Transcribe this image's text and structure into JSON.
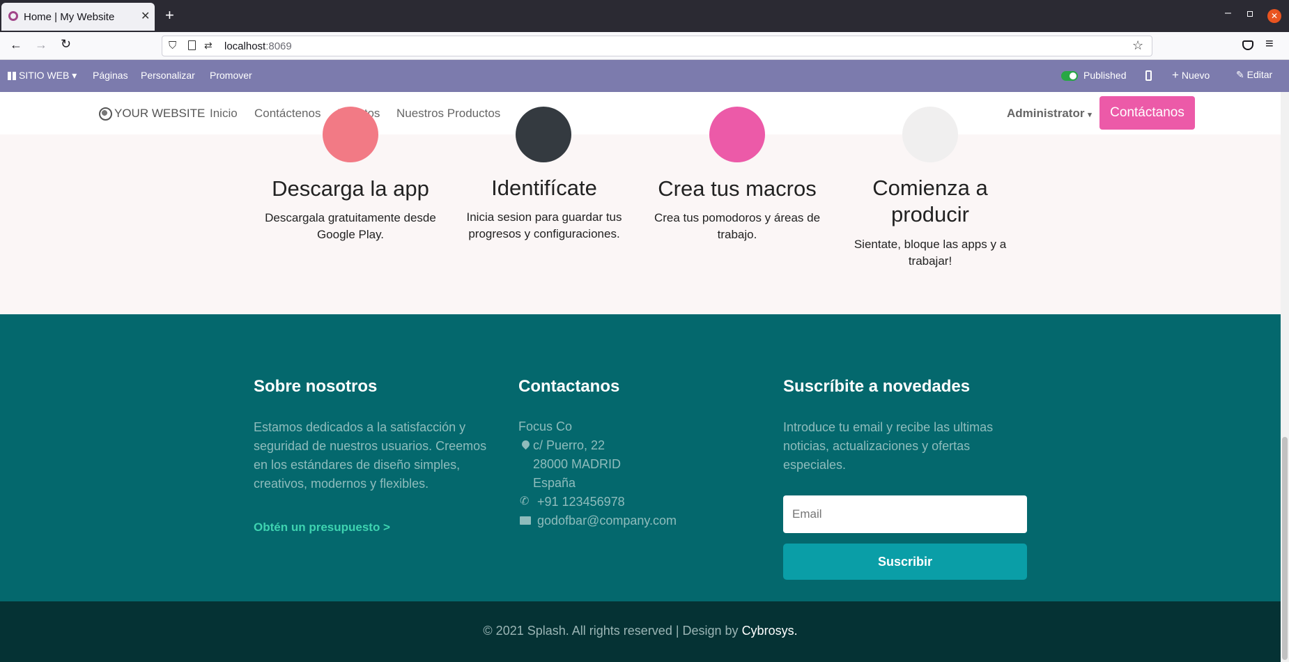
{
  "browser": {
    "tab_title": "Home | My Website",
    "url_host": "localhost",
    "url_port": ":8069"
  },
  "odoo_bar": {
    "site_menu": "SITIO WEB",
    "items": [
      "Páginas",
      "Personalizar",
      "Promover"
    ],
    "published": "Published",
    "new": "Nuevo",
    "edit": "Editar"
  },
  "site_header": {
    "logo": "YOUR WEBSITE",
    "nav": [
      "Inicio",
      "Contáctenos",
      "Eventos",
      "Nuestros Productos"
    ],
    "user": "Administrator",
    "cta": "Contáctanos"
  },
  "steps": [
    {
      "title": "Descarga la app",
      "text": "Descargala gratuitamente desde Google Play.",
      "color": "#f27a85"
    },
    {
      "title": "Identifícate",
      "text": "Inicia sesion para guardar tus progresos y configuraciones.",
      "color": "#343a40"
    },
    {
      "title": "Crea tus macros",
      "text": "Crea tus pomodoros y áreas de trabajo.",
      "color": "#ec5aa8"
    },
    {
      "title": "Comienza a producir",
      "text": "Sientate, bloque las apps y a trabajar!",
      "color": "#f0efef"
    }
  ],
  "footer": {
    "about": {
      "title": "Sobre nosotros",
      "text": "Estamos dedicados a la satisfacción y seguridad de nuestros usuarios. Creemos en los estándares de diseño simples, creativos, modernos y flexibles.",
      "link": "Obtén un presupuesto >"
    },
    "contact": {
      "title": "Contactanos",
      "company": "Focus Co",
      "street": "c/ Puerro, 22",
      "city": "28000 MADRID",
      "country": "España",
      "phone": "+91 123456978",
      "email": "godofbar@company.com"
    },
    "subscribe": {
      "title": "Suscríbite a novedades",
      "text": "Introduce tu email y recibe las ultimas noticias, actualizaciones y ofertas especiales.",
      "placeholder": "Email",
      "button": "Suscribir"
    }
  },
  "copyright": {
    "text": "© 2021 Splash. All rights reserved | Design by ",
    "brand": "Cybrosys."
  },
  "colors": {
    "odoo_bar": "#7c7bad",
    "cta": "#ec5aa8",
    "footer": "#04686d",
    "footer_bottom": "#053234",
    "link": "#3ed3b0",
    "subscribe_button": "#0a9ea7"
  }
}
